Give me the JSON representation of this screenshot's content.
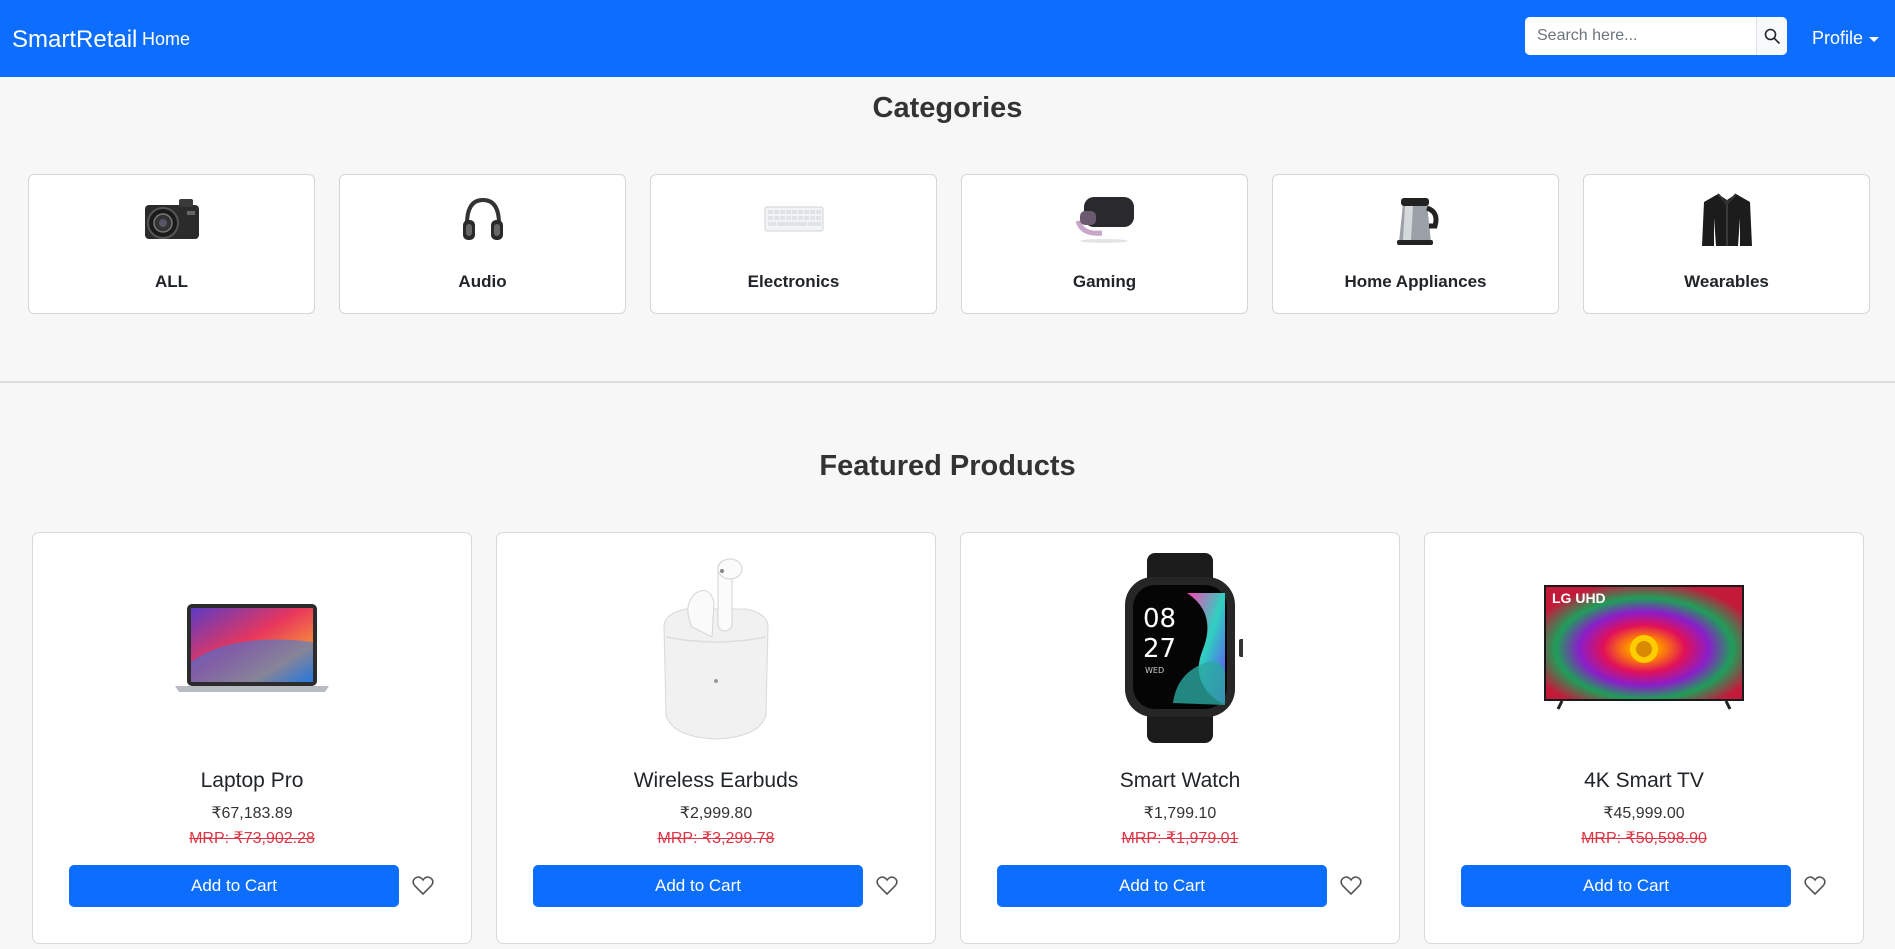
{
  "navbar": {
    "brand": "SmartRetail",
    "home": "Home",
    "search_placeholder": "Search here...",
    "profile": "Profile"
  },
  "categories": {
    "title": "Categories",
    "items": [
      {
        "label": "ALL",
        "icon": "camera-icon"
      },
      {
        "label": "Audio",
        "icon": "headphones-icon"
      },
      {
        "label": "Electronics",
        "icon": "keyboard-icon"
      },
      {
        "label": "Gaming",
        "icon": "vr-headset-icon"
      },
      {
        "label": "Home Appliances",
        "icon": "kettle-icon"
      },
      {
        "label": "Wearables",
        "icon": "jacket-icon"
      }
    ]
  },
  "featured": {
    "title": "Featured Products",
    "products": [
      {
        "name": "Laptop Pro",
        "price": "₹67,183.89",
        "mrp": "MRP: ₹73,902.28",
        "button": "Add to Cart",
        "image": "laptop-image"
      },
      {
        "name": "Wireless Earbuds",
        "price": "₹2,999.80",
        "mrp": "MRP: ₹3,299.78",
        "button": "Add to Cart",
        "image": "earbuds-image"
      },
      {
        "name": "Smart Watch",
        "price": "₹1,799.10",
        "mrp": "MRP: ₹1,979.01",
        "button": "Add to Cart",
        "image": "smartwatch-image"
      },
      {
        "name": "4K Smart TV",
        "price": "₹45,999.00",
        "mrp": "MRP: ₹50,598.90",
        "button": "Add to Cart",
        "image": "tv-image"
      }
    ],
    "watch_time": {
      "hour": "08",
      "minute": "27",
      "day": "WED"
    },
    "tv_brand": "LG UHD"
  },
  "colors": {
    "primary": "#0d6efd",
    "mrp_red": "#dc3545",
    "background": "#f7f7f7"
  }
}
